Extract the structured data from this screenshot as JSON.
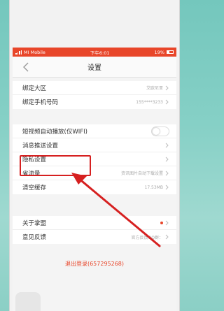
{
  "status_bar": {
    "carrier": "MI Mobile",
    "time": "下午6:01",
    "battery": "19%"
  },
  "nav": {
    "title": "设置"
  },
  "groups": [
    {
      "rows": [
        {
          "label": "绑定大区",
          "value": "艾欧尼亚"
        },
        {
          "label": "绑定手机号码",
          "value": "155****3233"
        }
      ]
    },
    {
      "rows": [
        {
          "label": "短视频自动播放(仅WIFI)",
          "value": ""
        },
        {
          "label": "消息推送设置",
          "value": ""
        },
        {
          "label": "隐私设置",
          "value": ""
        },
        {
          "label": "省流量",
          "value": "资讯图片自动下载设置"
        },
        {
          "label": "清空缓存",
          "value": "17.53MB"
        }
      ]
    },
    {
      "rows": [
        {
          "label": "关于掌盟",
          "value": ""
        },
        {
          "label": "意见反馈",
          "value": "官方反馈QQ群："
        }
      ]
    }
  ],
  "logout_label": "退出登录(657295268)",
  "colors": {
    "accent": "#e8462a",
    "highlight": "#d62020"
  },
  "icons": [
    "back-arrow-icon",
    "chevron-right-icon",
    "toggle-switch",
    "red-dot-badge"
  ]
}
